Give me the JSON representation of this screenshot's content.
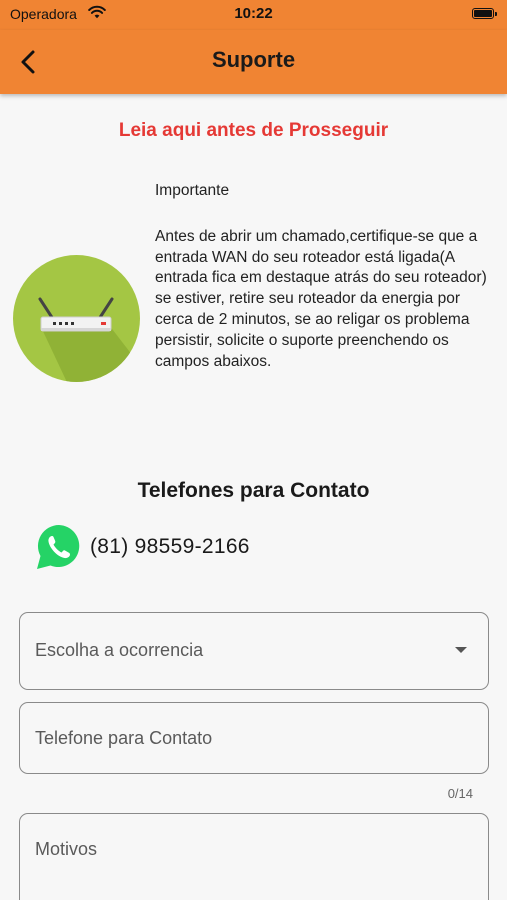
{
  "status_bar": {
    "carrier": "Operadora",
    "time": "10:22"
  },
  "app_bar": {
    "title": "Suporte"
  },
  "notice": {
    "heading": "Leia aqui antes de Prosseguir",
    "subheading": "Importante",
    "body": "Antes de abrir um chamado,certifique-se que a entrada WAN do seu roteador está ligada(A entrada fica em destaque atrás do seu roteador) se estiver, retire seu roteador da energia por cerca de 2 minutos, se ao religar os problema persistir, solicite o suporte preenchendo os campos abaixos."
  },
  "contact": {
    "title": "Telefones para Contato",
    "phone": "(81) 98559-2166"
  },
  "form": {
    "occurrence_placeholder": "Escolha a ocorrencia",
    "phone_placeholder": "Telefone para Contato",
    "phone_counter": "0/14",
    "reasons_placeholder": "Motivos"
  },
  "colors": {
    "accent": "#f08433",
    "warning": "#e53935",
    "whatsapp": "#25d366",
    "router_bg": "#a4c644"
  },
  "icons": [
    "wifi-icon",
    "battery-icon",
    "back-arrow-icon",
    "router-icon",
    "whatsapp-icon",
    "dropdown-arrow-icon"
  ]
}
